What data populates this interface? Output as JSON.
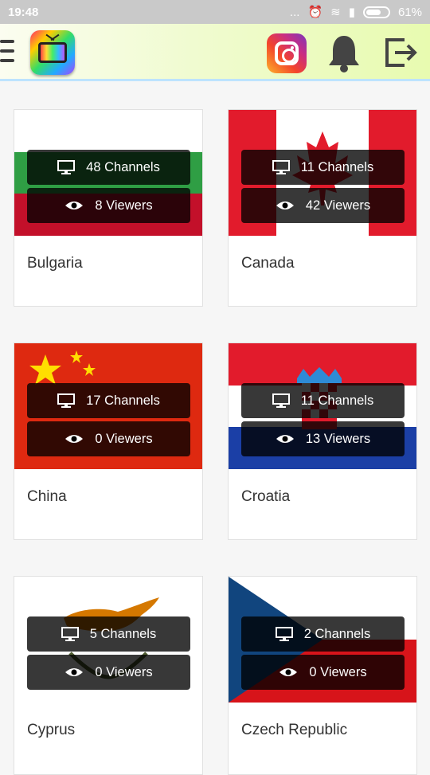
{
  "status_bar": {
    "time": "19:48",
    "indicators": "...",
    "battery": "61%"
  },
  "app_bar": {
    "menu_icon": "hamburger-icon",
    "logo_icon": "tv-app-icon",
    "instagram_icon": "instagram-icon",
    "notifications_icon": "bell-icon",
    "logout_icon": "logout-icon"
  },
  "countries": [
    {
      "name": "Bulgaria",
      "channels": "48 Channels",
      "viewers": "8 Viewers"
    },
    {
      "name": "Canada",
      "channels": "11 Channels",
      "viewers": "42 Viewers"
    },
    {
      "name": "China",
      "channels": "17 Channels",
      "viewers": "0 Viewers"
    },
    {
      "name": "Croatia",
      "channels": "11 Channels",
      "viewers": "13 Viewers"
    },
    {
      "name": "Cyprus",
      "channels": "5 Channels",
      "viewers": "0 Viewers"
    },
    {
      "name": "Czech Republic",
      "channels": "2 Channels",
      "viewers": "0 Viewers"
    }
  ],
  "colors": {
    "appbar_end": "#e8fbb0",
    "pill_bg": "#000000",
    "card_border": "#e1e1e1"
  }
}
